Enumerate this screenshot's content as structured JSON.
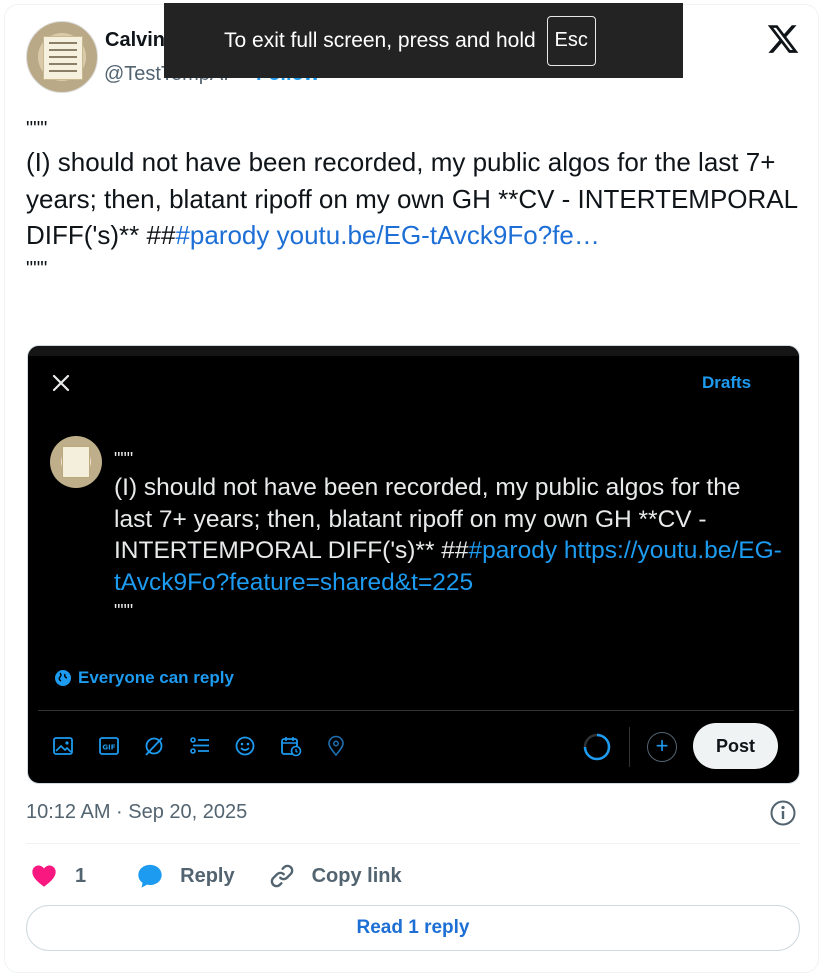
{
  "author": {
    "name": "Calvin",
    "handle": "@TestTempAI",
    "follow_label": "Follow"
  },
  "fullscreen_notice": {
    "message": "To exit full screen, press and hold",
    "key": "Esc"
  },
  "tweet": {
    "open_quote": "\"\"\"",
    "body": "(I) should not have been recorded, my public algos for the last 7+ years; then, blatant ripoff on my own GH **CV - INTERTEMPORAL DIFF('s)** ##",
    "hashtag": "#parody",
    "link": "youtu.be/EG-tAvck9Fo?fe…",
    "close_quote": "\"\"\"",
    "timestamp": "10:12 AM · Sep 20, 2025"
  },
  "media": {
    "drafts_label": "Drafts",
    "open_quote": "\"\"\"",
    "body": "(I) should not have been recorded, my public algos for the last 7+ years; then, blatant ripoff on my own GH **CV - INTERTEMPORAL DIFF('s)** ##",
    "hashtag": "#parody",
    "link": "https://youtu.be/EG-tAvck9Fo?feature=shared&t=225",
    "close_quote": "\"\"\"",
    "reply_setting": "Everyone can reply",
    "post_label": "Post",
    "toolbar_icons": [
      "image-icon",
      "gif-icon",
      "grok-icon",
      "poll-icon",
      "emoji-icon",
      "schedule-icon",
      "location-icon"
    ]
  },
  "actions": {
    "like_count": "1",
    "reply_label": "Reply",
    "copy_link_label": "Copy link"
  },
  "read_replies_label": "Read 1 reply",
  "colors": {
    "accent": "#1d9bf0",
    "like": "#f91880",
    "muted": "#536471"
  }
}
